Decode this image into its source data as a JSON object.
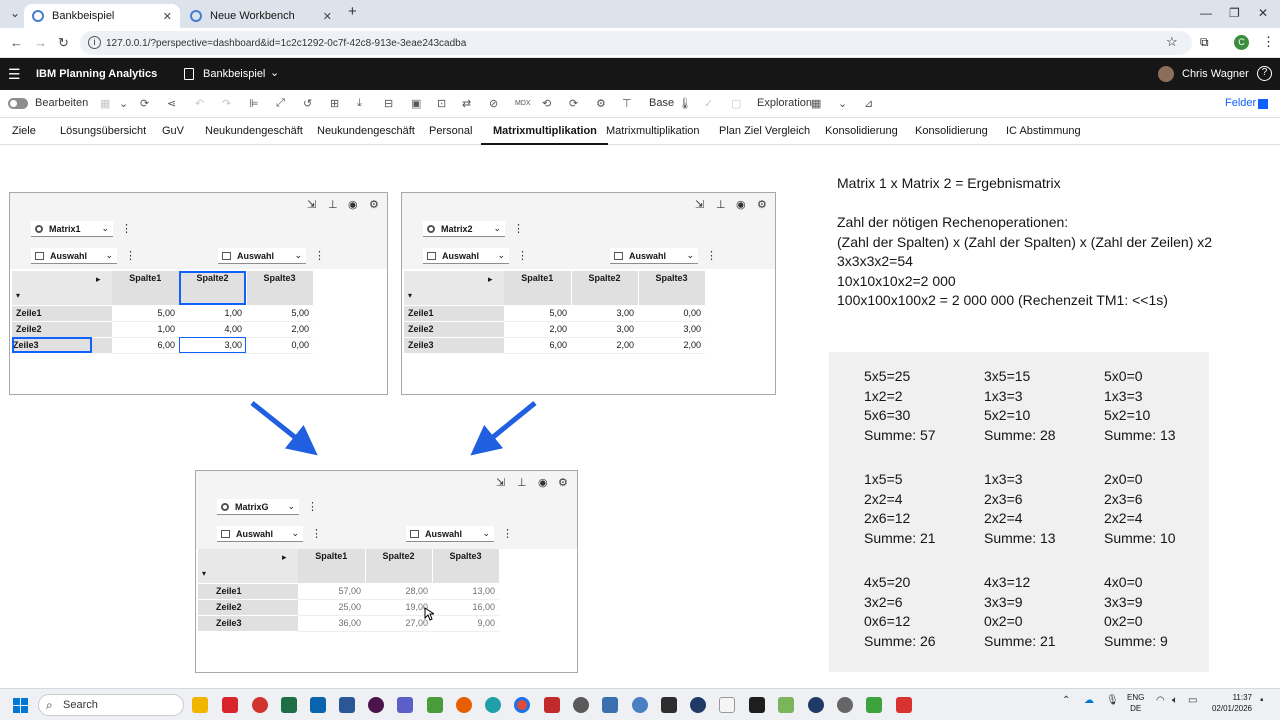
{
  "browser": {
    "tabs": [
      {
        "title": "Bankbeispiel",
        "active": true
      },
      {
        "title": "Neue Workbench",
        "active": false
      }
    ],
    "url": "127.0.0.1/?perspective=dashboard&id=1c2c1292-0c7f-42c8-913e-3eae243cadba",
    "profile_initial": "C"
  },
  "app": {
    "brand": "IBM Planning Analytics",
    "book_title": "Bankbeispiel",
    "user": "Chris Wagner"
  },
  "toolbar": {
    "edit_label": "Bearbeiten",
    "base_label": "Base",
    "exploration_label": "Exploration",
    "felder_label": "Felder"
  },
  "sheet_tabs": [
    "Ziele",
    "Lösungsübersicht",
    "GuV",
    "Neukundengeschäft",
    "Neukundengeschäft",
    "Personal",
    "Matrixmultiplikation",
    "Matrixmultiplikation",
    "Plan Ziel Vergleich",
    "Konsolidierung",
    "Konsolidierung",
    "IC Abstimmung"
  ],
  "active_sheet_index": 6,
  "widgets": [
    {
      "cube": "Matrix1",
      "row_selector": "Auswahl",
      "col_selector": "Auswahl",
      "columns": [
        "Spalte1",
        "Spalte2",
        "Spalte3"
      ],
      "rows": [
        {
          "label": "Zeile1",
          "values": [
            "5,00",
            "1,00",
            "5,00"
          ]
        },
        {
          "label": "Zeile2",
          "values": [
            "1,00",
            "4,00",
            "2,00"
          ]
        },
        {
          "label": "Zeile3",
          "values": [
            "6,00",
            "3,00",
            "0,00"
          ]
        }
      ]
    },
    {
      "cube": "Matrix2",
      "row_selector": "Auswahl",
      "col_selector": "Auswahl",
      "columns": [
        "Spalte1",
        "Spalte2",
        "Spalte3"
      ],
      "rows": [
        {
          "label": "Zeile1",
          "values": [
            "5,00",
            "3,00",
            "0,00"
          ]
        },
        {
          "label": "Zeile2",
          "values": [
            "2,00",
            "3,00",
            "3,00"
          ]
        },
        {
          "label": "Zeile3",
          "values": [
            "6,00",
            "2,00",
            "2,00"
          ]
        }
      ]
    },
    {
      "cube": "MatrixG",
      "row_selector": "Auswahl",
      "col_selector": "Auswahl",
      "columns": [
        "Spalte1",
        "Spalte2",
        "Spalte3"
      ],
      "rows": [
        {
          "label": "Zeile1",
          "values": [
            "57,00",
            "28,00",
            "13,00"
          ]
        },
        {
          "label": "Zeile2",
          "values": [
            "25,00",
            "19,00",
            "16,00"
          ]
        },
        {
          "label": "Zeile3",
          "values": [
            "36,00",
            "27,00",
            "9,00"
          ]
        }
      ]
    }
  ],
  "note": [
    "Matrix 1 x Matrix 2 = Ergebnismatrix",
    "",
    "Zahl der nötigen Rechenoperationen:",
    "(Zahl der Spalten) x (Zahl der Spalten) x (Zahl der Zeilen) x2",
    "3x3x3x2=54",
    "10x10x10x2=2 000",
    "100x100x100x2 = 2 000 000  (Rechenzeit TM1: <<1s)"
  ],
  "calc_grid": [
    [
      "5x5=25",
      "1x2=2",
      "5x6=30",
      "Summe: 57"
    ],
    [
      "3x5=15",
      "1x3=3",
      "5x2=10",
      "Summe: 28"
    ],
    [
      "5x0=0",
      "1x3=3",
      "5x2=10",
      "Summe: 13"
    ],
    [
      "1x5=5",
      "2x2=4",
      "2x6=12",
      "Summe: 21"
    ],
    [
      "1x3=3",
      "2x3=6",
      "2x2=4",
      "Summe: 13"
    ],
    [
      "2x0=0",
      "2x3=6",
      "2x2=4",
      "Summe: 10"
    ],
    [
      "4x5=20",
      "3x2=6",
      "0x6=12",
      "Summe: 26"
    ],
    [
      "4x3=12",
      "3x3=9",
      "0x2=0",
      "Summe: 21"
    ],
    [
      "4x0=0",
      "3x3=9",
      "0x2=0",
      "Summe: 9"
    ]
  ],
  "taskbar": {
    "search_placeholder": "Search",
    "lang": "ENG",
    "region": "DE",
    "time": "11:37",
    "date": "02/01/2026"
  },
  "colors": {
    "accent": "#0f62fe",
    "arrow": "#1f5fe0",
    "header_bg": "#161616"
  }
}
